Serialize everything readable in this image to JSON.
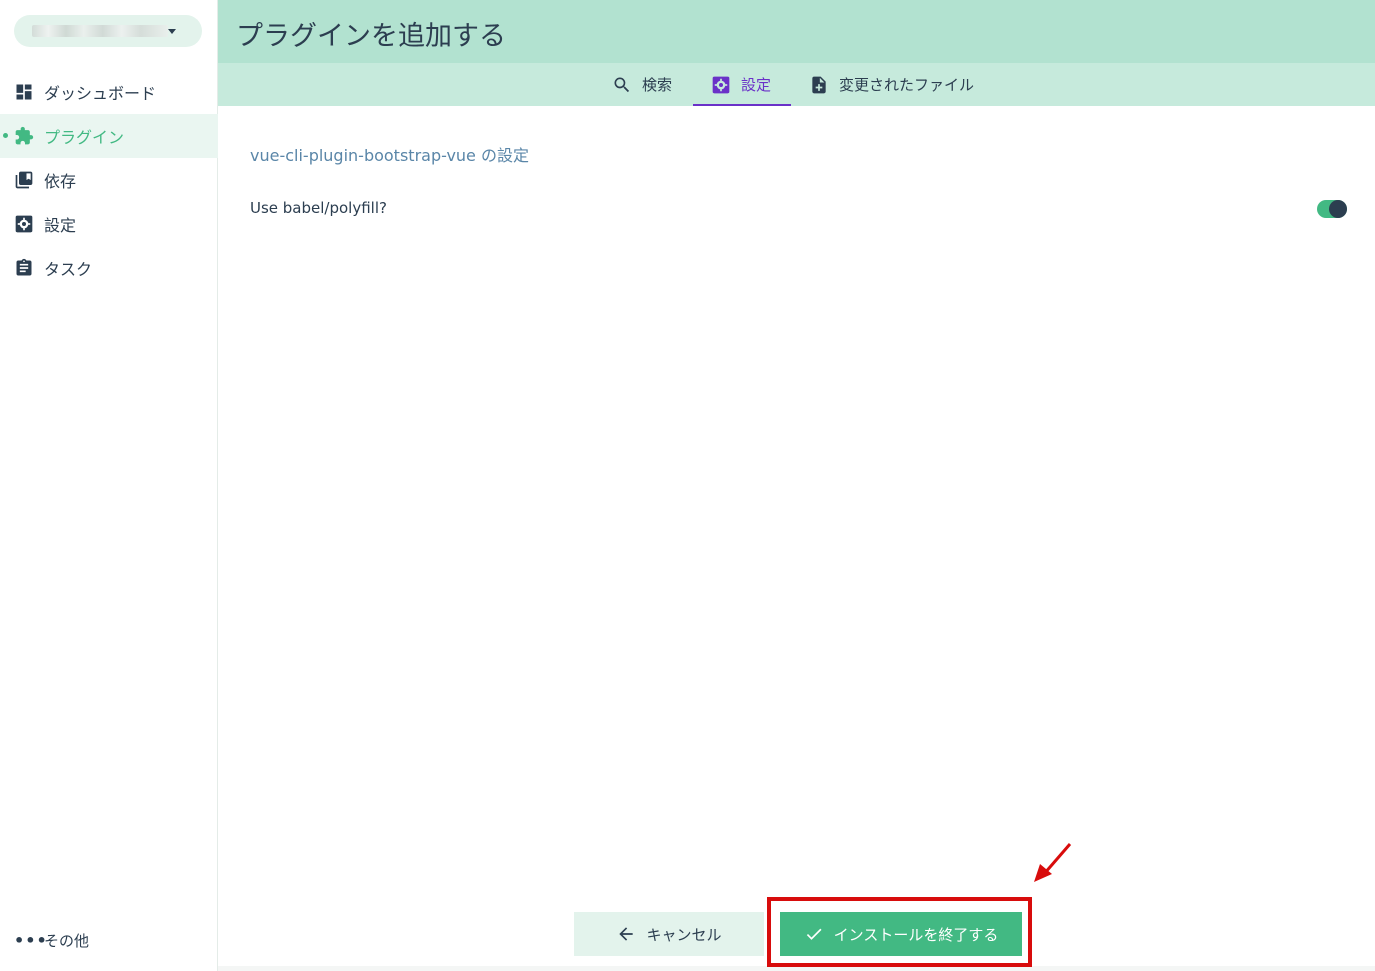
{
  "sidebar": {
    "project_selector": {
      "value": ""
    },
    "items": [
      {
        "label": "ダッシュボード",
        "icon": "dashboard-icon",
        "active": false
      },
      {
        "label": "プラグイン",
        "icon": "puzzle-icon",
        "active": true
      },
      {
        "label": "依存",
        "icon": "library-icon",
        "active": false
      },
      {
        "label": "設定",
        "icon": "settings-icon",
        "active": false
      },
      {
        "label": "タスク",
        "icon": "clipboard-icon",
        "active": false
      }
    ],
    "more_label": "その他"
  },
  "header": {
    "title": "プラグインを追加する"
  },
  "tabs": [
    {
      "label": "検索",
      "icon": "search-icon",
      "active": false
    },
    {
      "label": "設定",
      "icon": "settings-icon",
      "active": true
    },
    {
      "label": "変更されたファイル",
      "icon": "file-add-icon",
      "active": false
    }
  ],
  "config": {
    "section_title": "vue-cli-plugin-bootstrap-vue の設定",
    "prompts": [
      {
        "label": "Use babel/polyfill?",
        "type": "toggle",
        "value": true
      }
    ]
  },
  "actions": {
    "cancel_label": "キャンセル",
    "finish_label": "インストールを終了する"
  },
  "colors": {
    "accent": "#42b983",
    "header_bg": "#b2e2d0",
    "tab_active": "#6a31c8",
    "annotation": "#d80c0c",
    "text": "#2c3e50"
  }
}
